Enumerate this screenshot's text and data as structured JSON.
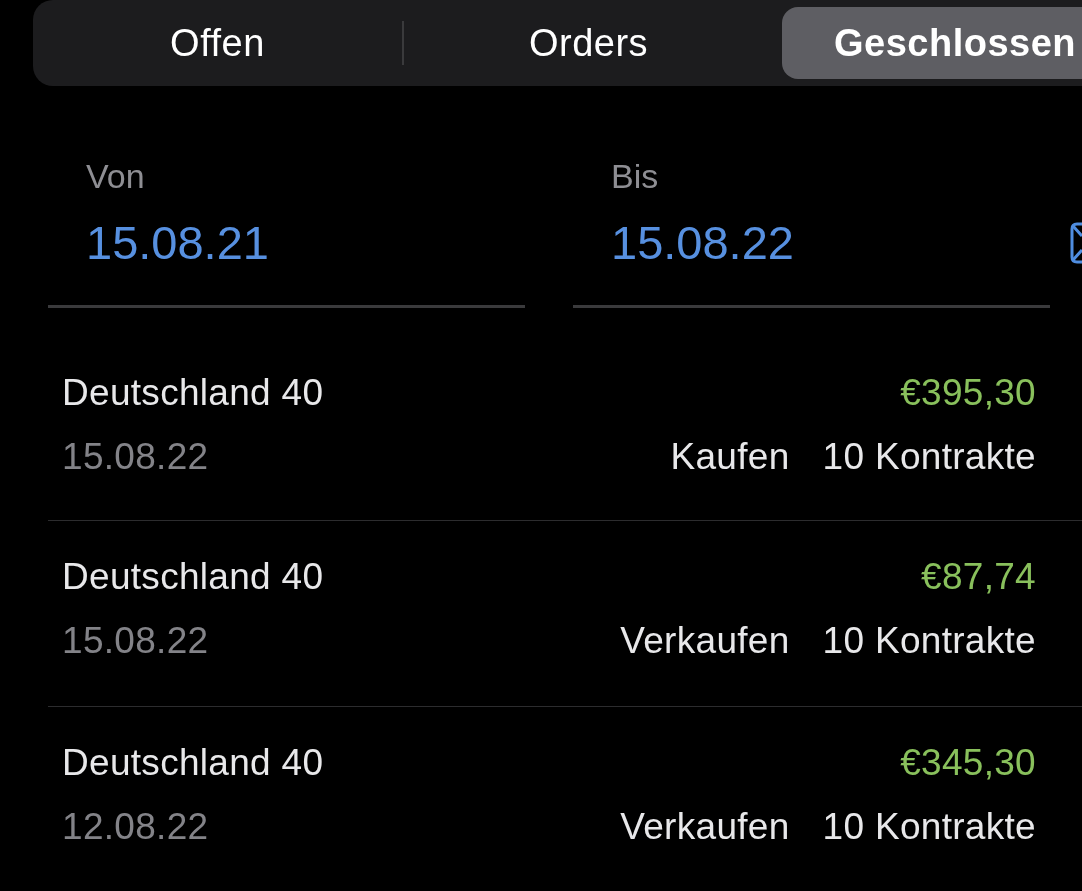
{
  "segmented_control": {
    "tabs": [
      {
        "label": "Offen",
        "selected": false
      },
      {
        "label": "Orders",
        "selected": false
      },
      {
        "label": "Geschlossen",
        "selected": true
      }
    ]
  },
  "date_range": {
    "fields": [
      {
        "label": "Von",
        "value": "15.08.21"
      },
      {
        "label": "Bis",
        "value": "15.08.22"
      }
    ]
  },
  "trades": [
    {
      "instrument": "Deutschland 40",
      "date": "15.08.22",
      "profit": "€395,30",
      "direction": "Kaufen",
      "size": "10 Kontrakte"
    },
    {
      "instrument": "Deutschland 40",
      "date": "15.08.22",
      "profit": "€87,74",
      "direction": "Verkaufen",
      "size": "10 Kontrakte"
    },
    {
      "instrument": "Deutschland 40",
      "date": "12.08.22",
      "profit": "€345,30",
      "direction": "Verkaufen",
      "size": "10 Kontrakte"
    }
  ]
}
